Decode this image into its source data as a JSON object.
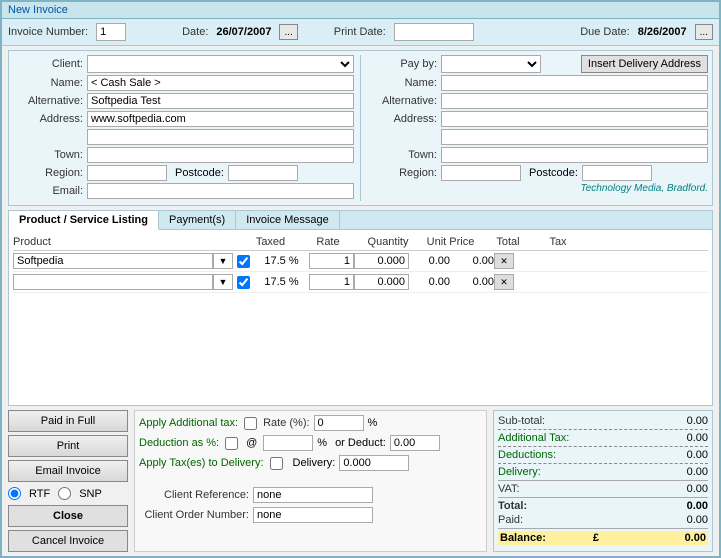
{
  "window": {
    "title": "New Invoice"
  },
  "toolbar": {
    "invoice_number_label": "Invoice Number:",
    "invoice_number_value": "1",
    "date_label": "Date:",
    "date_value": "26/07/2007",
    "date_btn": "...",
    "print_date_label": "Print Date:",
    "due_date_label": "Due Date:",
    "due_date_value": "8/26/2007",
    "due_date_btn": "..."
  },
  "client_section": {
    "client_label": "Client:",
    "payby_label": "Pay by:",
    "insert_btn": "Insert Delivery Address",
    "left": {
      "name_label": "Name:",
      "name_value": "< Cash Sale >",
      "alternative_label": "Alternative:",
      "alternative_value": "Softpedia Test",
      "address_label": "Address:",
      "address_value": "www.softpedia.com",
      "town_label": "Town:",
      "town_value": "",
      "region_label": "Region:",
      "region_value": "",
      "postcode_label": "Postcode:",
      "postcode_value": "",
      "email_label": "Email:",
      "email_value": ""
    },
    "right": {
      "name_label": "Name:",
      "name_value": "",
      "alternative_label": "Alternative:",
      "alternative_value": "",
      "address_label": "Address:",
      "address_value": "",
      "town_label": "Town:",
      "town_value": "",
      "region_label": "Region:",
      "region_value": "",
      "postcode_label": "Postcode:",
      "postcode_value": "",
      "location": "Technology Media, Bradford."
    }
  },
  "tabs": {
    "items": [
      "Product / Service Listing",
      "Payment(s)",
      "Invoice Message"
    ],
    "active": 0
  },
  "product_table": {
    "headers": {
      "product": "Product",
      "taxed": "Taxed",
      "rate": "Rate",
      "quantity": "Quantity",
      "unit_price": "Unit Price",
      "total": "Total",
      "tax": "Tax"
    },
    "rows": [
      {
        "product": "Softpedia",
        "taxed": true,
        "rate": "17.5 %",
        "quantity": "1",
        "unit_price": "0.000",
        "total": "0.00",
        "tax": "0.00"
      },
      {
        "product": "",
        "taxed": true,
        "rate": "17.5 %",
        "quantity": "1",
        "unit_price": "0.000",
        "total": "0.00",
        "tax": "0.00"
      }
    ]
  },
  "buttons": {
    "paid_in_full": "Paid in Full",
    "print": "Print",
    "email_invoice": "Email Invoice",
    "rtf": "RTF",
    "snp": "SNP",
    "close": "Close",
    "cancel_invoice": "Cancel Invoice"
  },
  "middle_form": {
    "apply_additional_tax_label": "Apply Additional tax:",
    "rate_pct_label": "Rate (%):",
    "rate_pct_value": "0",
    "pct_sign": "%",
    "deduction_label": "Deduction as %:",
    "at_label": "@",
    "pct_sign2": "%",
    "or_deduct_label": "or Deduct:",
    "or_deduct_value": "0.00",
    "apply_tax_delivery_label": "Apply Tax(es) to Delivery:",
    "delivery_label": "Delivery:",
    "delivery_value": "0.000",
    "client_ref_label": "Client Reference:",
    "client_ref_value": "none",
    "client_order_label": "Client Order Number:",
    "client_order_value": "none"
  },
  "totals": {
    "sub_total_label": "Sub-total:",
    "sub_total_value": "0.00",
    "additional_tax_label": "Additional Tax:",
    "additional_tax_value": "0.00",
    "deductions_label": "Deductions:",
    "deductions_value": "0.00",
    "delivery_label": "Delivery:",
    "delivery_value": "0.00",
    "vat_label": "VAT:",
    "vat_value": "0.00",
    "total_label": "Total:",
    "total_value": "0.00",
    "paid_label": "Paid:",
    "paid_value": "0.00",
    "balance_label": "Balance:",
    "balance_currency": "£",
    "balance_value": "0.00"
  }
}
